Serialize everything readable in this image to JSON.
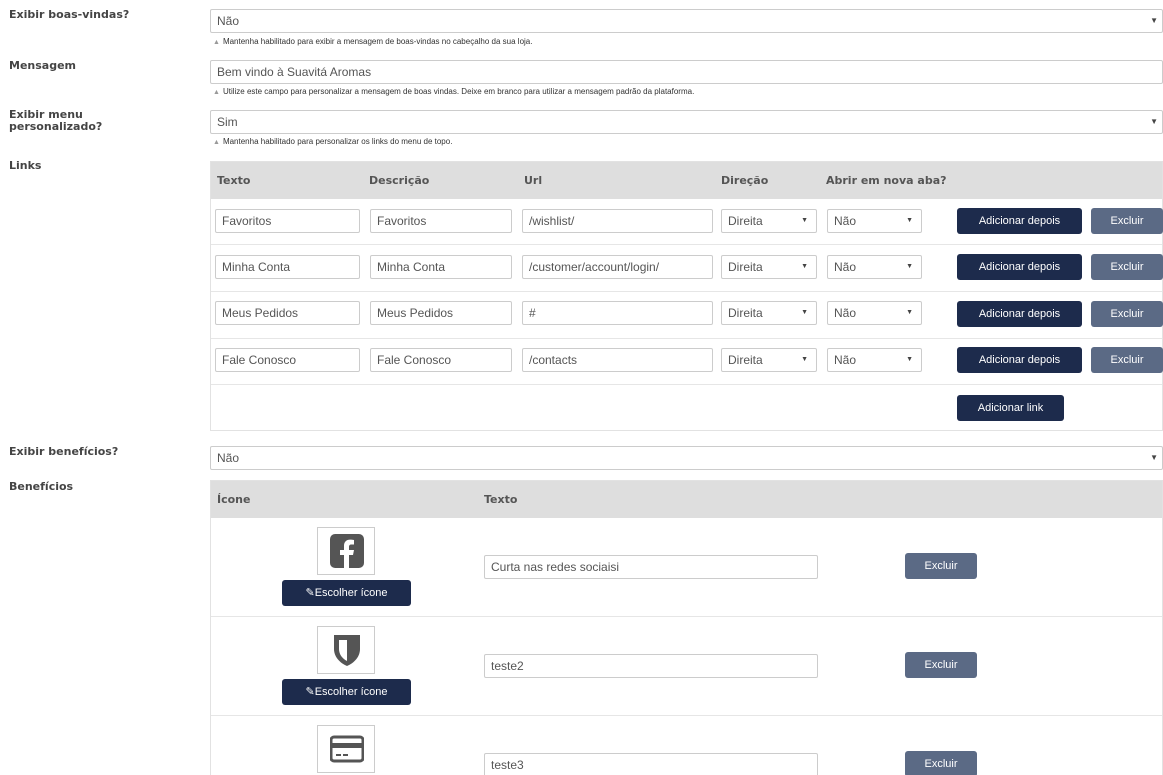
{
  "welcome": {
    "label": "Exibir boas-vindas?",
    "value": "Não",
    "hint": "Mantenha habilitado para exibir a mensagem de boas-vindas no cabeçalho da sua loja."
  },
  "message": {
    "label": "Mensagem",
    "value": "Bem vindo à Suavitá Aromas",
    "hint": "Utilize este campo para personalizar a mensagem de boas vindas. Deixe em branco para utilizar a mensagem padrão da plataforma."
  },
  "custom_menu": {
    "label_line1": "Exibir menu",
    "label_line2": "personalizado?",
    "value": "Sim",
    "hint": "Mantenha habilitado para personalizar os links do menu de topo."
  },
  "links": {
    "label": "Links",
    "headers": {
      "text": "Texto",
      "description": "Descrição",
      "url": "Url",
      "direction": "Direção",
      "new_tab": "Abrir em nova aba?"
    },
    "rows": [
      {
        "text": "Favoritos",
        "description": "Favoritos",
        "url": "/wishlist/",
        "direction": "Direita",
        "new_tab": "Não"
      },
      {
        "text": "Minha Conta",
        "description": "Minha Conta",
        "url": "/customer/account/login/",
        "direction": "Direita",
        "new_tab": "Não"
      },
      {
        "text": "Meus Pedidos",
        "description": "Meus Pedidos",
        "url": "#",
        "direction": "Direita",
        "new_tab": "Não"
      },
      {
        "text": "Fale Conosco",
        "description": "Fale Conosco",
        "url": "/contacts",
        "direction": "Direita",
        "new_tab": "Não"
      }
    ],
    "add_after_label": "Adicionar depois",
    "delete_label": "Excluir",
    "add_link_label": "Adicionar link"
  },
  "benefits_toggle": {
    "label": "Exibir benefícios?",
    "value": "Não"
  },
  "benefits": {
    "label": "Benefícios",
    "headers": {
      "icon": "Ícone",
      "text": "Texto"
    },
    "rows": [
      {
        "icon": "facebook-icon",
        "text": "Curta nas redes sociaisi"
      },
      {
        "icon": "shield-icon",
        "text": "teste2"
      },
      {
        "icon": "credit-card-icon",
        "text": "teste3"
      }
    ],
    "choose_icon_label": "Escolher ícone",
    "delete_label": "Excluir"
  },
  "colors": {
    "primary_button": "#1d2b4c",
    "secondary_button": "#5b6a85",
    "table_header": "#dedede"
  }
}
